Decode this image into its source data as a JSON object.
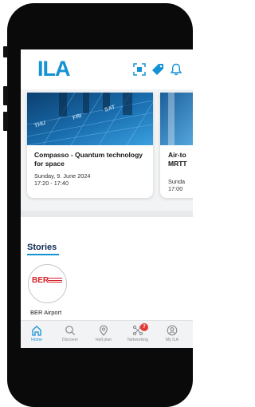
{
  "header": {
    "logo_text": "ILA",
    "icons": [
      "qr-scan-icon",
      "tag-icon",
      "bell-icon"
    ]
  },
  "cards": [
    {
      "title": "Compasso - Quantum technology for space",
      "date": "Sunday, 9. June 2024",
      "time": "17:20 - 17:40",
      "image_text": [
        "THU",
        "FRI",
        "SAT"
      ]
    },
    {
      "title": "Air-to",
      "title_line2": "MRTT",
      "date": "Sunda",
      "time": "17:00"
    }
  ],
  "stories": {
    "title": "Stories",
    "items": [
      {
        "label": "BER Airport",
        "logo_text": "BER"
      }
    ]
  },
  "tabbar": {
    "items": [
      {
        "label": "Home",
        "icon": "home-icon",
        "active": true
      },
      {
        "label": "Discover",
        "icon": "search-icon"
      },
      {
        "label": "Hall plan",
        "icon": "map-pin-icon"
      },
      {
        "label": "Networking",
        "icon": "network-icon",
        "badge": "7"
      },
      {
        "label": "My ILA",
        "icon": "profile-icon"
      }
    ]
  },
  "colors": {
    "brand_blue": "#1592d3",
    "heading_navy": "#0e2a55",
    "badge_red": "#e53935",
    "ber_red": "#d6202a"
  }
}
